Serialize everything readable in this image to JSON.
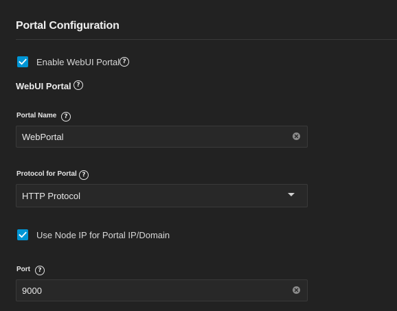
{
  "section": {
    "title": "Portal Configuration"
  },
  "enable_portal": {
    "label": "Enable WebUI Portal",
    "checked": true
  },
  "webui_portal": {
    "label": "WebUI Portal"
  },
  "portal_name": {
    "label": "Portal Name",
    "value": "WebPortal"
  },
  "protocol": {
    "label": "Protocol for Portal",
    "selected": "HTTP Protocol"
  },
  "use_node_ip": {
    "label": "Use Node IP for Portal IP/Domain",
    "checked": true
  },
  "port": {
    "label": "Port",
    "value": "9000"
  },
  "help_glyph": "?",
  "icons": {
    "checkbox": "check-icon",
    "help": "help-circle-icon",
    "clear": "clear-x-circle-icon",
    "dropdown": "caret-down-icon"
  },
  "colors": {
    "background": "#222222",
    "accent": "#0095d5",
    "field_bg": "#282828",
    "field_border": "#3a3a3a"
  }
}
